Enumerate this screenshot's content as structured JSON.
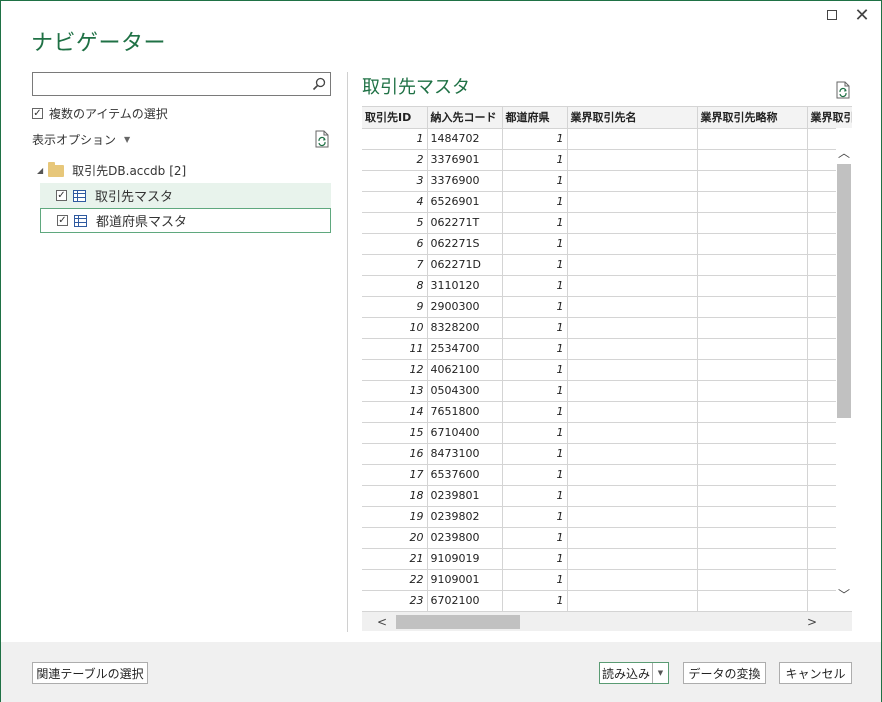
{
  "window": {
    "title": "ナビゲーター",
    "maximize_icon": "maximize-icon",
    "close_icon": "close-icon"
  },
  "left": {
    "search": {
      "value": "",
      "placeholder": ""
    },
    "multi_select_label": "複数のアイテムの選択",
    "multi_select_checked": true,
    "display_options_label": "表示オプション",
    "tree": {
      "root_label": "取引先DB.accdb",
      "root_count": "[2]",
      "items": [
        {
          "label": "取引先マスタ",
          "checked": true,
          "selected": true
        },
        {
          "label": "都道府県マスタ",
          "checked": true,
          "selected": false
        }
      ]
    }
  },
  "preview": {
    "title": "取引先マスタ",
    "columns": [
      "取引先ID",
      "納入先コード",
      "都道府県",
      "業界取引先名",
      "業界取引先略称",
      "業界取引"
    ],
    "rows": [
      [
        "1",
        "1484702",
        "1"
      ],
      [
        "2",
        "3376901",
        "1"
      ],
      [
        "3",
        "3376900",
        "1"
      ],
      [
        "4",
        "6526901",
        "1"
      ],
      [
        "5",
        "062271T",
        "1"
      ],
      [
        "6",
        "062271S",
        "1"
      ],
      [
        "7",
        "062271D",
        "1"
      ],
      [
        "8",
        "3110120",
        "1"
      ],
      [
        "9",
        "2900300",
        "1"
      ],
      [
        "10",
        "8328200",
        "1"
      ],
      [
        "11",
        "2534700",
        "1"
      ],
      [
        "12",
        "4062100",
        "1"
      ],
      [
        "13",
        "0504300",
        "1"
      ],
      [
        "14",
        "7651800",
        "1"
      ],
      [
        "15",
        "6710400",
        "1"
      ],
      [
        "16",
        "8473100",
        "1"
      ],
      [
        "17",
        "6537600",
        "1"
      ],
      [
        "18",
        "0239801",
        "1"
      ],
      [
        "19",
        "0239802",
        "1"
      ],
      [
        "20",
        "0239800",
        "1"
      ],
      [
        "21",
        "9109019",
        "1"
      ],
      [
        "22",
        "9109001",
        "1"
      ],
      [
        "23",
        "6702100",
        "1"
      ]
    ]
  },
  "footer": {
    "related_tables_label": "関連テーブルの選択",
    "load_label": "読み込み",
    "transform_label": "データの変換",
    "cancel_label": "キャンセル"
  },
  "colors": {
    "accent": "#1f7145",
    "selection": "#e8f3ec",
    "footer_bg": "#f0f0f0"
  }
}
